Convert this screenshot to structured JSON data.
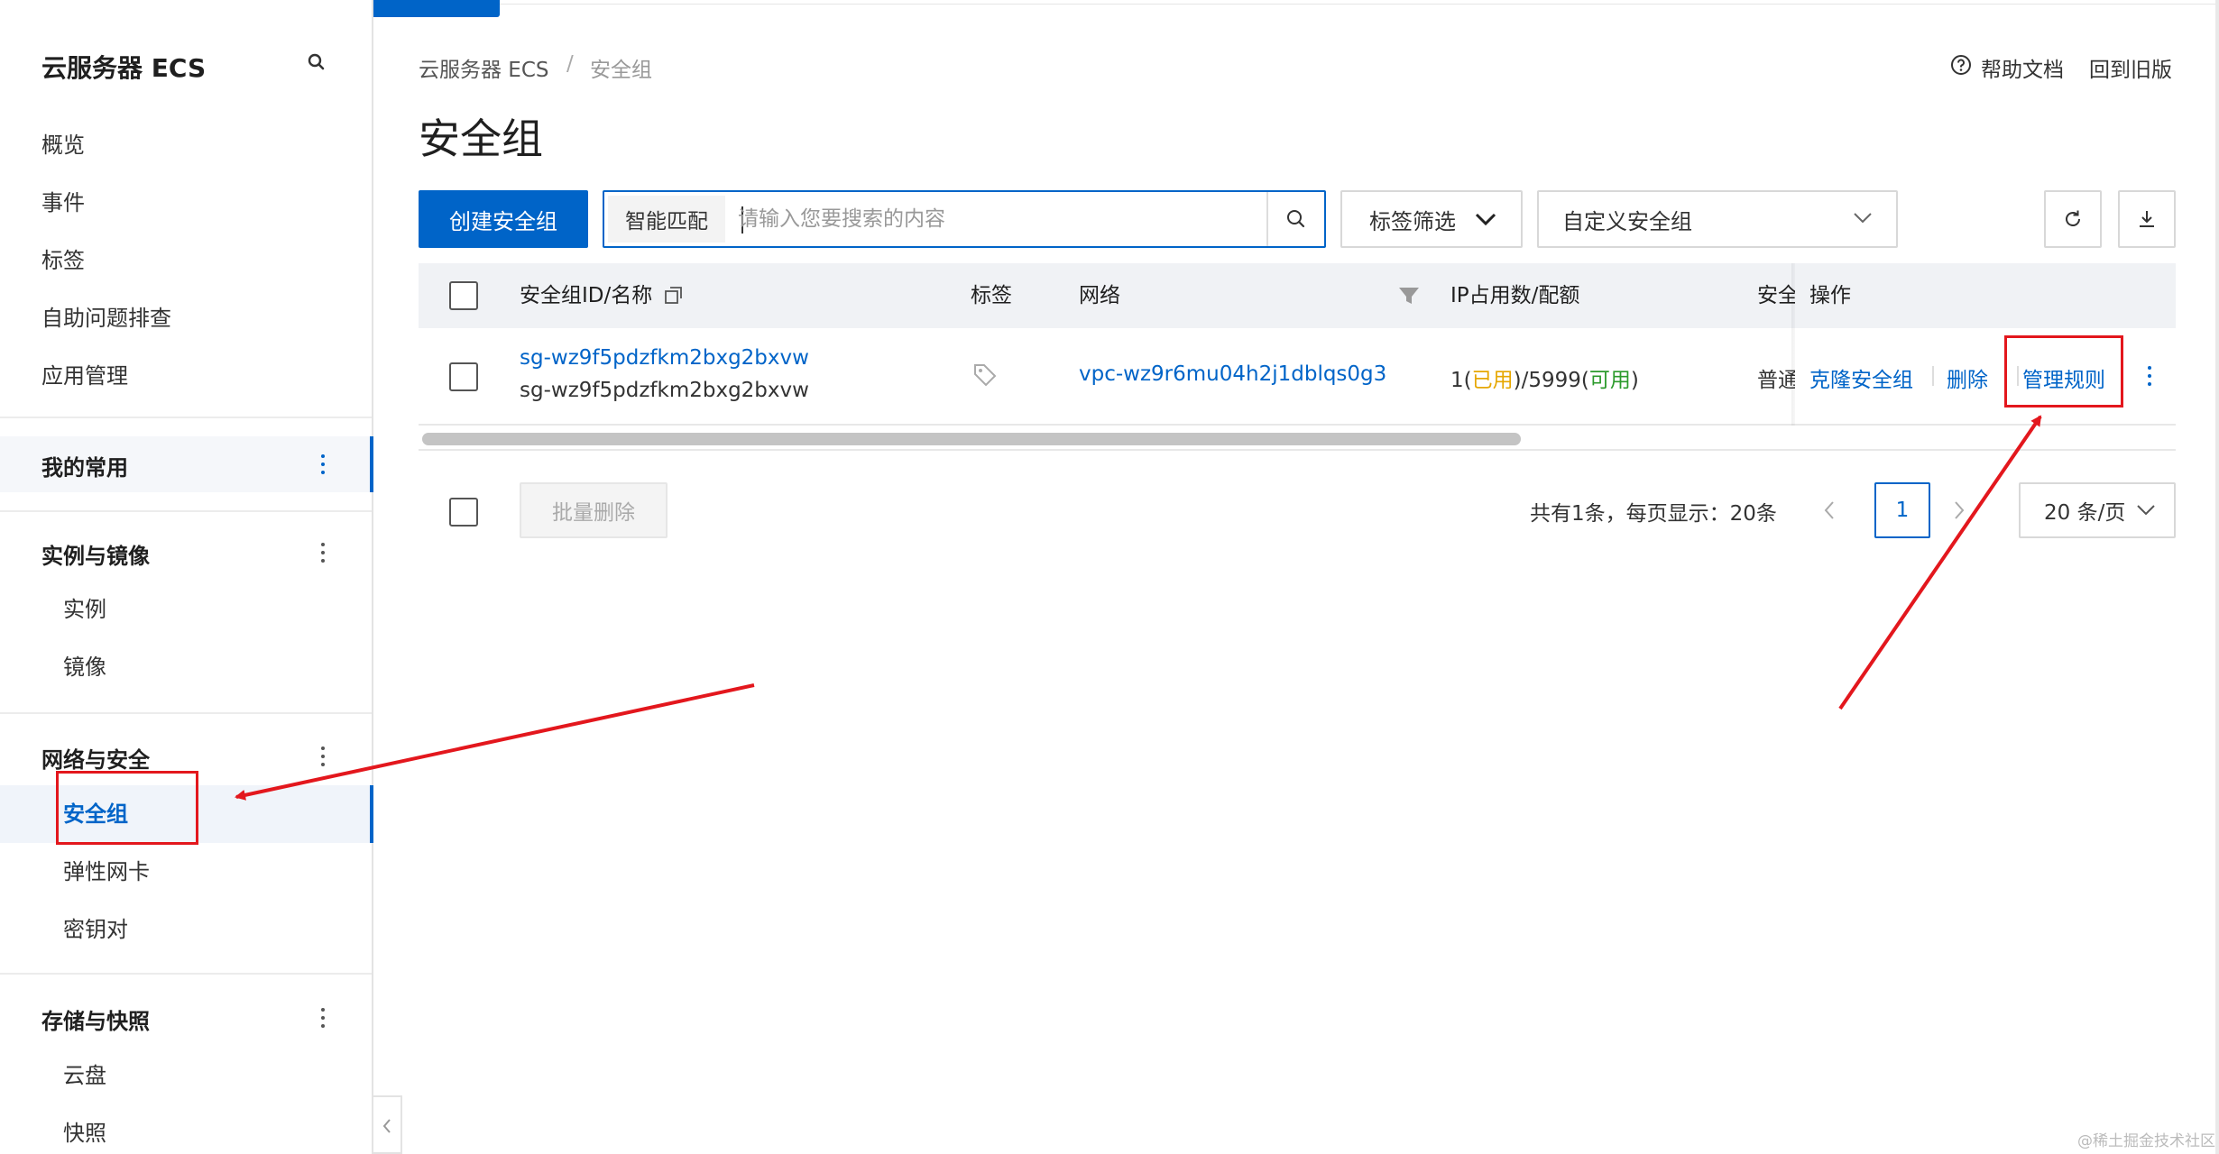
{
  "sidebar": {
    "title": "云服务器 ECS",
    "top_items": [
      "概览",
      "事件",
      "标签",
      "自助问题排查",
      "应用管理"
    ],
    "favorites_label": "我的常用",
    "groups": {
      "instances": {
        "label": "实例与镜像",
        "items": [
          "实例",
          "镜像"
        ]
      },
      "network": {
        "label": "网络与安全",
        "items": [
          "安全组",
          "弹性网卡",
          "密钥对"
        ]
      },
      "storage": {
        "label": "存储与快照",
        "items": [
          "云盘",
          "快照"
        ]
      }
    }
  },
  "breadcrumb": {
    "root": "云服务器 ECS",
    "separator": "/",
    "current": "安全组"
  },
  "page_title": "安全组",
  "header_links": {
    "help": "帮助文档",
    "old_version": "回到旧版"
  },
  "toolbar": {
    "create_label": "创建安全组",
    "search_mode": "智能匹配",
    "search_placeholder": "请输入您要搜索的内容",
    "tag_filter_label": "标签筛选",
    "custom_group_label": "自定义安全组"
  },
  "table": {
    "headers": {
      "id_name": "安全组ID/名称",
      "tag": "标签",
      "network": "网络",
      "ip_quota": "IP占用数/配额",
      "type": "安全",
      "ops": "操作"
    },
    "rows": [
      {
        "id": "sg-wz9f5pdzfkm2bxg2bxvw",
        "name": "sg-wz9f5pdzfkm2bxg2bxvw",
        "network": "vpc-wz9r6mu04h2j1dblqs0g3",
        "ip_used": "1",
        "ip_used_label": "已用",
        "ip_available": "5999",
        "ip_available_label": "可用",
        "type": "普通",
        "ops": {
          "clone": "克隆安全组",
          "delete": "删除",
          "manage": "管理规则"
        }
      }
    ]
  },
  "footer": {
    "batch_delete": "批量删除",
    "summary": "共有1条，每页显示：20条",
    "current_page": "1",
    "page_size": "20 条/页"
  },
  "colors": {
    "primary": "#0064c8",
    "annotation": "#e3171d",
    "used": "#e6a700",
    "available": "#2b9a2b"
  },
  "watermark": "@稀土掘金技术社区"
}
